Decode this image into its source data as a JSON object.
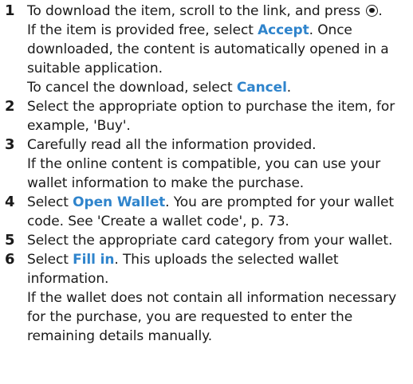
{
  "colors": {
    "keyword": "#2f84cc",
    "text": "#1a1a1a"
  },
  "steps": [
    {
      "number": "1",
      "lines": [
        {
          "a": "To download the item, scroll to the link, and press",
          "icon": "select-key-icon",
          "b": "."
        },
        {
          "a": "If the item is provided free, select ",
          "kw": "Accept",
          "b": ". Once"
        },
        {
          "a": "downloaded, the content is automatically opened in a"
        },
        {
          "a": "suitable application."
        },
        {
          "a": "To cancel the download, select ",
          "kw": "Cancel",
          "b": "."
        }
      ]
    },
    {
      "number": "2",
      "lines": [
        {
          "a": "Select the appropriate option to purchase the item, for"
        },
        {
          "a": "example, 'Buy'."
        }
      ]
    },
    {
      "number": "3",
      "lines": [
        {
          "a": "Carefully read all the information provided."
        },
        {
          "a": "If the online content is compatible, you can use your"
        },
        {
          "a": "wallet information to make the purchase."
        }
      ]
    },
    {
      "number": "4",
      "lines": [
        {
          "a": "Select ",
          "kw": "Open Wallet",
          "b": ". You are prompted for your wallet"
        },
        {
          "a": "code. See 'Create a wallet code', p. 73."
        }
      ]
    },
    {
      "number": "5",
      "lines": [
        {
          "a": "Select the appropriate card category from your wallet."
        }
      ]
    },
    {
      "number": "6",
      "lines": [
        {
          "a": "Select ",
          "kw": "Fill in",
          "b": ". This uploads the selected wallet"
        },
        {
          "a": "information."
        },
        {
          "a": "If the wallet does not contain all information necessary"
        },
        {
          "a": "for the purchase, you are requested to enter the"
        },
        {
          "a": "remaining details manually."
        }
      ]
    }
  ]
}
